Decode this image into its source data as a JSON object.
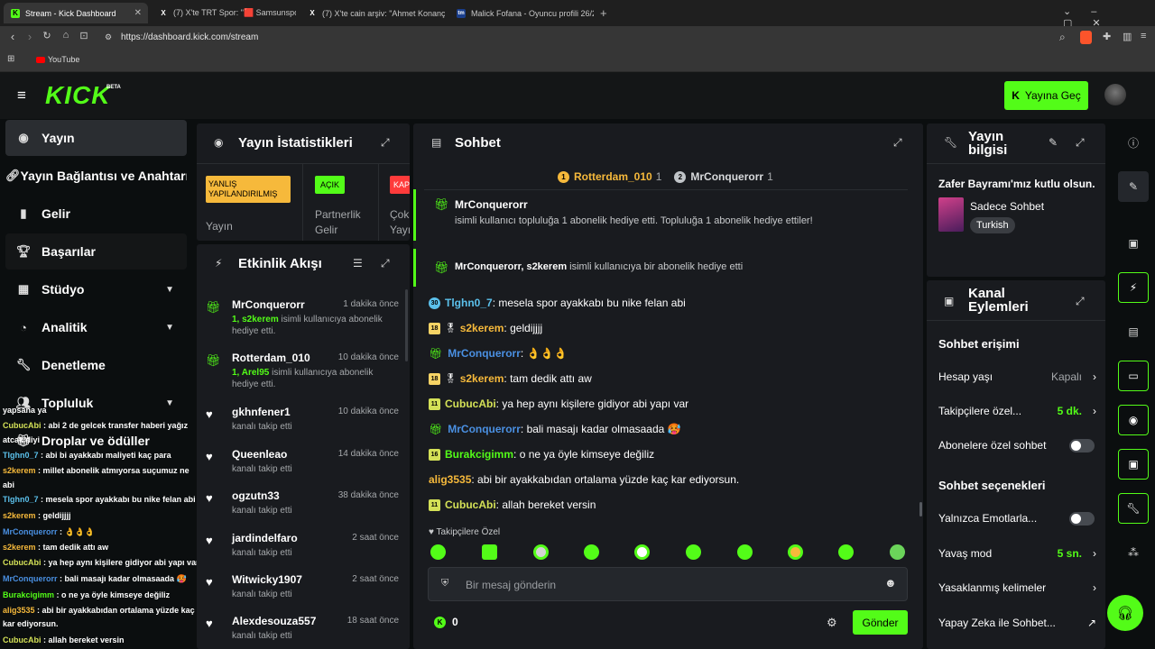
{
  "browser": {
    "tabs": [
      {
        "title": "Stream - Kick Dashboard",
        "fav": "K",
        "active": true
      },
      {
        "title": "(7) X'te TRT Spor: \"🟥 Samsunspor x",
        "fav": "X",
        "active": false
      },
      {
        "title": "(7) X'te cain arşiv: \"Ahmet Konanç - R",
        "fav": "X",
        "active": false
      },
      {
        "title": "Malick Fofana - Oyuncu profili 26/27",
        "fav": "tm",
        "active": false
      }
    ],
    "url": "https://dashboard.kick.com/stream",
    "bookmark": "YouTube"
  },
  "header": {
    "logo": "KICK",
    "beta": "BETA",
    "go_live": "Yayına Geç"
  },
  "nav": {
    "items": [
      {
        "label": "Yayın"
      },
      {
        "label": "Yayın Bağlantısı ve Anahtarı"
      },
      {
        "label": "Gelir"
      },
      {
        "label": "Başarılar"
      },
      {
        "label": "Stüdyo"
      },
      {
        "label": "Analitik"
      },
      {
        "label": "Denetleme"
      },
      {
        "label": "Topluluk"
      },
      {
        "label": "Droplar ve ödüller"
      }
    ]
  },
  "stats": {
    "title": "Yayın İstatistikleri",
    "cards": [
      {
        "badge": "YANLIŞ YAPILANDIRILMIŞ",
        "label": "Yayın",
        "color": "#f6b93b"
      },
      {
        "badge": "AÇIK",
        "label": "Partnerlik Gelir",
        "color": "#53fc18"
      },
      {
        "badge": "KAP",
        "label": "Çok Yayı",
        "color": "#ff3b3b"
      }
    ]
  },
  "activity": {
    "title": "Etkinlik Akışı",
    "events": [
      {
        "name": "MrConquerorr",
        "time": "1 dakika önce",
        "hl": "1, s2kerem",
        "desc": " isimli kullanıcıya abonelik hediye etti.",
        "icon": "gift"
      },
      {
        "name": "Rotterdam_010",
        "time": "10 dakika önce",
        "hl": "1, Arel95",
        "desc": " isimli kullanıcıya abonelik hediye etti.",
        "icon": "gift"
      },
      {
        "name": "gkhnfener1",
        "time": "10 dakika önce",
        "hl": "",
        "desc": "kanalı takip etti",
        "icon": "heart"
      },
      {
        "name": "Queenleao",
        "time": "14 dakika önce",
        "hl": "",
        "desc": "kanalı takip etti",
        "icon": "heart"
      },
      {
        "name": "ogzutn33",
        "time": "38 dakika önce",
        "hl": "",
        "desc": "kanalı takip etti",
        "icon": "heart"
      },
      {
        "name": "jardindelfaro",
        "time": "2 saat önce",
        "hl": "",
        "desc": "kanalı takip etti",
        "icon": "heart"
      },
      {
        "name": "Witwicky1907",
        "time": "2 saat önce",
        "hl": "",
        "desc": "kanalı takip etti",
        "icon": "heart"
      },
      {
        "name": "Alexdesouza557",
        "time": "18 saat önce",
        "hl": "",
        "desc": "kanalı takip etti",
        "icon": "heart"
      }
    ]
  },
  "chat": {
    "title": "Sohbet",
    "leaders": [
      {
        "rank": "1",
        "name": "Rotterdam_010",
        "count": "1"
      },
      {
        "rank": "2",
        "name": "MrConquerorr",
        "count": "1"
      }
    ],
    "gift1": {
      "name": "MrConquerorr",
      "text": "isimli kullanıcı topluluğa 1 abonelik hediye etti. Topluluğa 1 abonelik hediye ettiler!"
    },
    "gift2": {
      "name": "MrConquerorr, s2kerem",
      "text": " isimli kullanıcıya bir abonelik hediye etti"
    },
    "messages": [
      {
        "badge": "30",
        "badge_color": "#5bc0eb",
        "user": "Tlghn0_7",
        "user_color": "#5bc0eb",
        "text": ": mesela spor ayakkabı bu nike felan abi"
      },
      {
        "badge": "18",
        "badge_color": "#f6d365",
        "user": "s2kerem",
        "user_color": "#f6b93b",
        "text": ": geldijjjj"
      },
      {
        "badge": "🎁",
        "badge_color": "#53fc18",
        "user": "MrConquerorr",
        "user_color": "#4a90e2",
        "text": ": 👌👌👌"
      },
      {
        "badge": "18",
        "badge_color": "#f6d365",
        "user": "s2kerem",
        "user_color": "#f6b93b",
        "text": ": tam dedik attı aw"
      },
      {
        "badge": "11",
        "badge_color": "#d4e157",
        "user": "CubucAbi",
        "user_color": "#d4e157",
        "text": ": ya hep aynı kişilere gidiyor abi yapı var"
      },
      {
        "badge": "🎁",
        "badge_color": "#53fc18",
        "user": "MrConquerorr",
        "user_color": "#4a90e2",
        "text": ": bali masajı kadar olmasaada 🥵"
      },
      {
        "badge": "16",
        "badge_color": "#d4e157",
        "user": "Burakcigimm",
        "user_color": "#53fc18",
        "text": ": o ne ya öyle kimseye değiliz"
      },
      {
        "badge": "",
        "badge_color": "",
        "user": "alig3535",
        "user_color": "#f6b93b",
        "text": ": abi bir ayakkabıdan ortalama yüzde kaç kar ediyorsun."
      },
      {
        "badge": "11",
        "badge_color": "#d4e157",
        "user": "CubucAbi",
        "user_color": "#d4e157",
        "text": ": allah bereket versin"
      }
    ],
    "followers_only": "Takipçilere Özel",
    "input_placeholder": "Bir mesaj gönderin",
    "kick_count": "0",
    "send_label": "Gönder"
  },
  "stream_info": {
    "title": "Yayın bilgisi",
    "stream_title": "Zafer Bayramı'mız kutlu olsun.",
    "category": "Sadece Sohbet",
    "tag": "Turkish"
  },
  "channel_actions": {
    "title": "Kanal Eylemleri",
    "chat_access_title": "Sohbet erişimi",
    "rows1": [
      {
        "label": "Hesap yaşı",
        "value": "Kapalı",
        "kind": "chevron"
      },
      {
        "label": "Takipçilere özel...",
        "value": "5 dk.",
        "kind": "chevron-green"
      },
      {
        "label": "Abonelere özel sohbet",
        "value": "",
        "kind": "toggle"
      }
    ],
    "chat_options_title": "Sohbet seçenekleri",
    "rows2": [
      {
        "label": "Yalnızca Emotlarla...",
        "value": "",
        "kind": "toggle"
      },
      {
        "label": "Yavaş mod",
        "value": "5 sn.",
        "kind": "chevron-green"
      },
      {
        "label": "Yasaklanmış kelimeler",
        "value": "",
        "kind": "chevron"
      },
      {
        "label": "Yapay Zeka ile Sohbet...",
        "value": "",
        "kind": "external"
      }
    ]
  },
  "overlay_chat": [
    {
      "user": "",
      "text": "yapsana ya",
      "color": "#ffffff"
    },
    {
      "user": "CubucAbi",
      "text": " : abi 2 de gelcek transfer haberi yağız",
      "color": "#d4e157"
    },
    {
      "user": "",
      "text": "atcak diyi",
      "color": "#ffffff"
    },
    {
      "user": "Tlghn0_7",
      "text": " : abi bi ayakkabı maliyeti kaç para",
      "color": "#5bc0eb"
    },
    {
      "user": "s2kerem",
      "text": " : millet abonelik atmıyorsa suçumuz ne",
      "color": "#f6b93b"
    },
    {
      "user": "",
      "text": "abi",
      "color": "#ffffff"
    },
    {
      "user": "Tlghn0_7",
      "text": " : mesela spor ayakkabı bu nike felan abi",
      "color": "#5bc0eb"
    },
    {
      "user": "s2kerem",
      "text": " : geldijjjj",
      "color": "#f6b93b"
    },
    {
      "user": "MrConquerorr",
      "text": " : 👌👌👌",
      "color": "#4a90e2"
    },
    {
      "user": "s2kerem",
      "text": " : tam dedik attı aw",
      "color": "#f6b93b"
    },
    {
      "user": "CubucAbi",
      "text": " : ya hep aynı kişilere gidiyor abi yapı var",
      "color": "#d4e157"
    },
    {
      "user": "MrConquerorr",
      "text": " : bali masajı kadar olmasaada 🥵",
      "color": "#4a90e2"
    },
    {
      "user": "Burakcigimm",
      "text": " : o ne ya öyle kimseye değiliz",
      "color": "#53fc18"
    },
    {
      "user": "alig3535",
      "text": " : abi bir ayakkabıdan ortalama yüzde kaç",
      "color": "#f6b93b"
    },
    {
      "user": "",
      "text": "kar ediyorsun.",
      "color": "#ffffff"
    },
    {
      "user": "CubucAbi",
      "text": " : allah bereket versin",
      "color": "#d4e157"
    }
  ],
  "colors": {
    "accent": "#53fc18",
    "panel": "#191b1f",
    "bg": "#0b0e0f"
  }
}
